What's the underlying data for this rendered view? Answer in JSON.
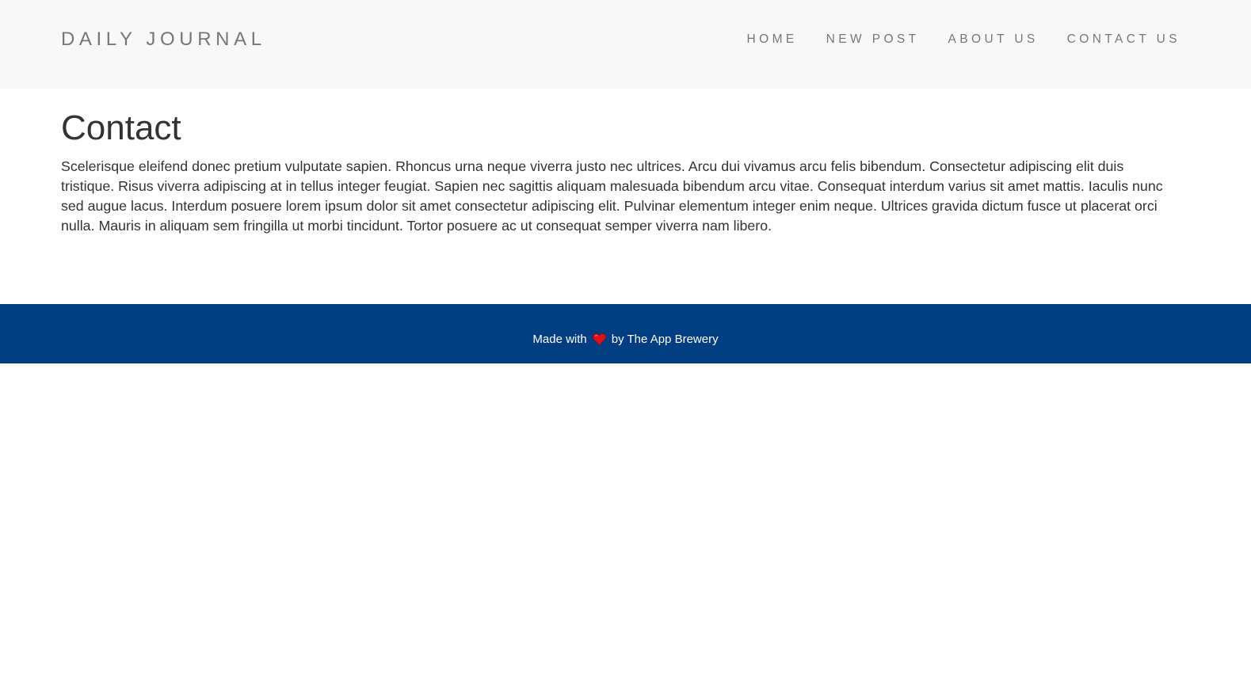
{
  "navbar": {
    "brand": "DAILY JOURNAL",
    "links": [
      {
        "label": "HOME"
      },
      {
        "label": "NEW POST"
      },
      {
        "label": "ABOUT US"
      },
      {
        "label": "CONTACT US"
      }
    ]
  },
  "main": {
    "title": "Contact",
    "body": "Scelerisque eleifend donec pretium vulputate sapien. Rhoncus urna neque viverra justo nec ultrices. Arcu dui vivamus arcu felis bibendum. Consectetur adipiscing elit duis tristique. Risus viverra adipiscing at in tellus integer feugiat. Sapien nec sagittis aliquam malesuada bibendum arcu vitae. Consequat interdum varius sit amet mattis. Iaculis nunc sed augue lacus. Interdum posuere lorem ipsum dolor sit amet consectetur adipiscing elit. Pulvinar elementum integer enim neque. Ultrices gravida dictum fusce ut placerat orci nulla. Mauris in aliquam sem fringilla ut morbi tincidunt. Tortor posuere ac ut consequat semper viverra nam libero."
  },
  "footer": {
    "prefix": "Made with",
    "icon": "heart-icon",
    "suffix": "by The App Brewery"
  },
  "colors": {
    "navbar_bg": "#f8f8f8",
    "nav_text": "#777777",
    "footer_bg": "#013d81",
    "heart": "#e0101a"
  }
}
